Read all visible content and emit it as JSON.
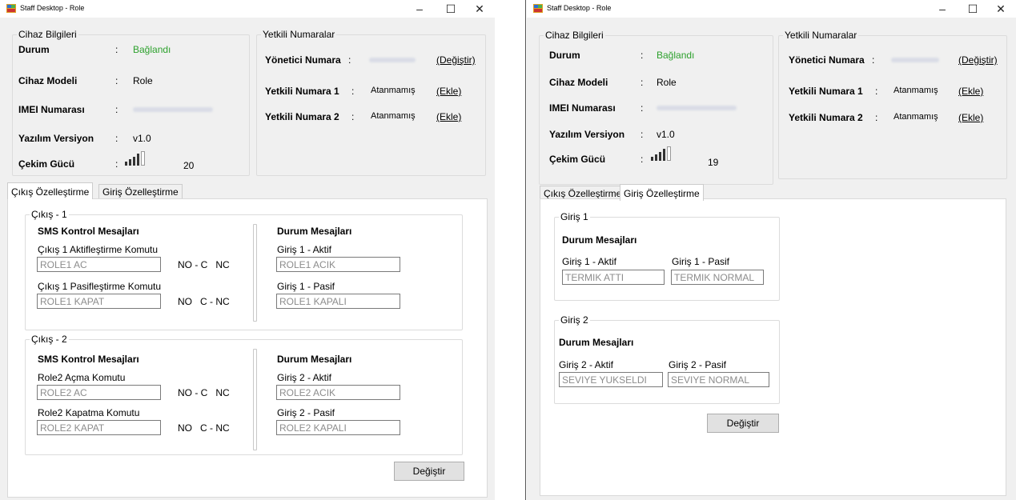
{
  "window_title": "Staff Desktop - Role",
  "controls": {
    "minimize": "–",
    "maximize": "☐",
    "close": "✕"
  },
  "device_group": {
    "title": "Cihaz Bilgileri",
    "status_label": "Durum",
    "status_value": "Bağlandı",
    "model_label": "Cihaz Modeli",
    "model_value": "Role",
    "imei_label": "IMEI Numarası",
    "software_label": "Yazılım Versiyon",
    "software_value": "v1.0",
    "signal_label": "Çekim Gücü",
    "colon": ":"
  },
  "numbers_group": {
    "title": "Yetkili Numaralar",
    "admin_label": "Yönetici Numara",
    "admin_action": "(Değiştir)",
    "auth1_label": "Yetkili Numara 1",
    "auth2_label": "Yetkili Numara 2",
    "unassigned": "Atanmamış",
    "add_action": "(Ekle)"
  },
  "left_window": {
    "signal_value": "20",
    "tabs": [
      "Çıkış Özelleştirme",
      "Giriş Özelleştirme"
    ],
    "outputs": [
      {
        "title": "Çıkış - 1",
        "sms_heading": "SMS Kontrol Mesajları",
        "on_label": "Çıkış 1 Aktifleştirme Komutu",
        "on_value": "ROLE1 AC",
        "on_mode": "NO - C   NC",
        "off_label": "Çıkış 1 Pasifleştirme Komutu",
        "off_value": "ROLE1 KAPAT",
        "off_mode": "NO   C - NC",
        "status_heading": "Durum Mesajları",
        "active_label": "Giriş 1 - Aktif",
        "active_value": "ROLE1 ACIK",
        "passive_label": "Giriş 1 - Pasif",
        "passive_value": "ROLE1 KAPALI"
      },
      {
        "title": "Çıkış - 2",
        "sms_heading": "SMS Kontrol Mesajları",
        "on_label": "Role2 Açma Komutu",
        "on_value": "ROLE2 AC",
        "on_mode": "NO - C   NC",
        "off_label": "Role2 Kapatma Komutu",
        "off_value": "ROLE2 KAPAT",
        "off_mode": "NO   C - NC",
        "status_heading": "Durum Mesajları",
        "active_label": "Giriş 2 - Aktif",
        "active_value": "ROLE2 ACIK",
        "passive_label": "Giriş 2 - Pasif",
        "passive_value": "ROLE2 KAPALI"
      }
    ],
    "button": "Değiştir"
  },
  "right_window": {
    "signal_value": "19",
    "tabs": [
      "Çıkış Özelleştirme",
      "Giriş Özelleştirme"
    ],
    "inputs": [
      {
        "title": "Giriş 1",
        "heading": "Durum Mesajları",
        "active_label": "Giriş 1 - Aktif",
        "active_value": "TERMIK ATTI",
        "passive_label": "Giriş 1 - Pasif",
        "passive_value": "TERMIK NORMAL"
      },
      {
        "title": "Giriş 2",
        "heading": "Durum Mesajları",
        "active_label": "Giriş 2 - Aktif",
        "active_value": "SEVIYE YUKSELDI",
        "passive_label": "Giriş 2 - Pasif",
        "passive_value": "SEVIYE NORMAL"
      }
    ],
    "button": "Değiştir"
  }
}
